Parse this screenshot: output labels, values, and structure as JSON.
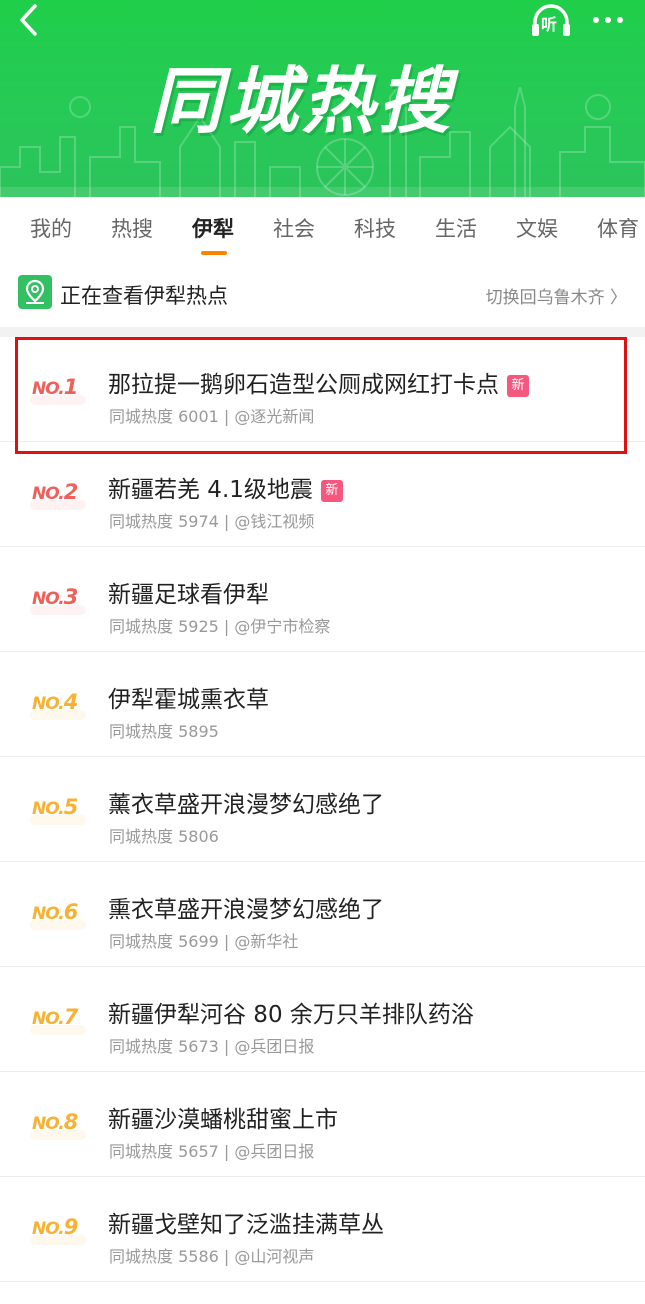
{
  "header": {
    "title": "同城热搜",
    "listen_label": "听",
    "back_icon": "chevron-left-icon",
    "more_icon": "more-dots-icon",
    "bg_color": "#27c957"
  },
  "tabs": [
    {
      "label": "我的"
    },
    {
      "label": "热搜"
    },
    {
      "label": "伊犁",
      "active": true
    },
    {
      "label": "社会"
    },
    {
      "label": "科技"
    },
    {
      "label": "生活"
    },
    {
      "label": "文娱"
    },
    {
      "label": "体育"
    }
  ],
  "location": {
    "text": "正在查看伊犁热点",
    "switch_label": "切换回乌鲁木齐 〉",
    "icon": "location-pin-icon"
  },
  "list": {
    "new_badge_label": "新",
    "items": [
      {
        "rank_prefix": "NO.",
        "rank_num": "1",
        "title": "那拉提一鹅卵石造型公厕成网红打卡点",
        "new": true,
        "meta": "同城热度 6001 | @逐光新闻"
      },
      {
        "rank_prefix": "NO.",
        "rank_num": "2",
        "title": "新疆若羌 4.1级地震",
        "new": true,
        "meta": "同城热度 5974 | @钱江视频"
      },
      {
        "rank_prefix": "NO.",
        "rank_num": "3",
        "title": "新疆足球看伊犁",
        "new": false,
        "meta": "同城热度 5925 | @伊宁市检察"
      },
      {
        "rank_prefix": "NO.",
        "rank_num": "4",
        "title": "伊犁霍城熏衣草",
        "new": false,
        "meta": "同城热度 5895"
      },
      {
        "rank_prefix": "NO.",
        "rank_num": "5",
        "title": "薰衣草盛开浪漫梦幻感绝了",
        "new": false,
        "meta": "同城热度 5806"
      },
      {
        "rank_prefix": "NO.",
        "rank_num": "6",
        "title": "熏衣草盛开浪漫梦幻感绝了",
        "new": false,
        "meta": "同城热度 5699 | @新华社"
      },
      {
        "rank_prefix": "NO.",
        "rank_num": "7",
        "title": "新疆伊犁河谷 80 余万只羊排队药浴",
        "new": false,
        "meta": "同城热度 5673 | @兵团日报"
      },
      {
        "rank_prefix": "NO.",
        "rank_num": "8",
        "title": "新疆沙漠蟠桃甜蜜上市",
        "new": false,
        "meta": "同城热度 5657 | @兵团日报"
      },
      {
        "rank_prefix": "NO.",
        "rank_num": "9",
        "title": "新疆戈壁知了泛滥挂满草丛",
        "new": false,
        "meta": "同城热度 5586 | @山河视声"
      }
    ]
  },
  "colors": {
    "accent": "#ff8200",
    "rank_hot": "#f0605a",
    "rank_warm": "#f7b234",
    "new_badge": "#f5577f",
    "highlight": "#e01010"
  }
}
